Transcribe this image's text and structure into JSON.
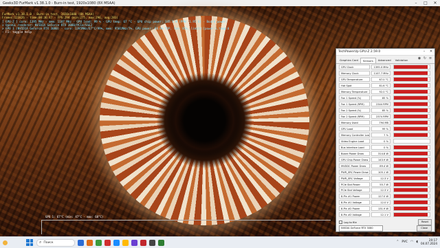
{
  "furmark": {
    "title": "Geeks3D FurMark v1.38.1.0 - Burn-in test, 1920x1080 (8X MSAA)",
    "overlay": [
      {
        "text": "FurMark v1.38.1.0 - Burn-in test, 1920x1080 (8X MSAA)",
        "style": "yellow"
      },
      {
        "text": "Frames:123826 - time:00:36:47 - FPS:294 (min:275, max:296, avg:283)",
        "style": "yellow"
      },
      {
        "text": "[ GPU-Z ] core: 1395 MHz - mem: 1107 MHz - GPU load: 99 % - GPU temp: 67 °C - GPU chip power: 145.3 W (PPW: 1.95 6) - Board power: 314.8 W (PPW: 0.935) - GPU voltage: 0.737 V",
        "style": "cyan"
      },
      {
        "text": "> OpenGL renderer: NVIDIA GeForce RTX 3080/PCIe/SSE2",
        "style": "cyan"
      },
      {
        "text": "> GPU 1 (NVIDIA GeForce RTX 3080) - core: 1395MHz/67°C/99%, mem: 9501MHz/7%, GPU power: 98.0% TDP, fan: 85%, limits:[power:1,temp:0,volt:0, OV:0]",
        "style": "cyan"
      },
      {
        "text": "- F1: toggle help",
        "style": "white"
      }
    ],
    "gpu_graph_label": "GPU 1: 67°C (min: 47°C - max: 68°C)"
  },
  "gpuz": {
    "title": "TechPowerUp GPU-Z 2.59.0",
    "tabs": [
      "Graphics Card",
      "Sensors",
      "Advanced",
      "Validation"
    ],
    "active_tab": "Sensors",
    "sensors": [
      {
        "name": "GPU Clock",
        "value": "1395.0 MHz",
        "level": 0.95
      },
      {
        "name": "Memory Clock",
        "value": "1107.7 MHz",
        "level": 0.95
      },
      {
        "name": "GPU Temperature",
        "value": "67.0 °C",
        "level": 0.95
      },
      {
        "name": "Hot Spot",
        "value": "81.6 °C",
        "level": 0.95
      },
      {
        "name": "Memory Temperature",
        "value": "92.0 °C",
        "level": 0.95
      },
      {
        "name": "Fan 1 Speed (%)",
        "value": "85 %",
        "level": 0.95
      },
      {
        "name": "Fan 1 Speed (RPM)",
        "value": "2344 RPM",
        "level": 0.95
      },
      {
        "name": "Fan 2 Speed (%)",
        "value": "85 %",
        "level": 0.95
      },
      {
        "name": "Fan 2 Speed (RPM)",
        "value": "2374 RPM",
        "level": 0.95
      },
      {
        "name": "Memory Used",
        "value": "794 MB",
        "level": 0.95
      },
      {
        "name": "GPU Load",
        "value": "99 %",
        "level": 0.95
      },
      {
        "name": "Memory Controller Load",
        "value": "7 %",
        "level": 0.95
      },
      {
        "name": "Video Engine Load",
        "value": "0 %",
        "level": 0.0
      },
      {
        "name": "Bus Interface Load",
        "value": "0 %",
        "level": 0.95
      },
      {
        "name": "Board Power Draw",
        "value": "314.8 W",
        "level": 0.95
      },
      {
        "name": "GPU Chip Power Draw",
        "value": "143.9 W",
        "level": 0.95
      },
      {
        "name": "MVDDC Power Draw",
        "value": "89.4 W",
        "level": 0.95
      },
      {
        "name": "PWR_SRC Power Draw",
        "value": "105.1 W",
        "level": 0.95
      },
      {
        "name": "PWR_SRC Voltage",
        "value": "12.3 V",
        "level": 0.95
      },
      {
        "name": "PCIe Slot Power",
        "value": "55.7 W",
        "level": 0.95
      },
      {
        "name": "PCIe Slot Voltage",
        "value": "12.3 V",
        "level": 0.95
      },
      {
        "name": "8-Pin #1 Power",
        "value": "127.0 W",
        "level": 0.95
      },
      {
        "name": "8-Pin #1 Voltage",
        "value": "12.0 V",
        "level": 0.95
      },
      {
        "name": "8-Pin #2 Power",
        "value": "131.9 W",
        "level": 0.95
      },
      {
        "name": "8-Pin #2 Voltage",
        "value": "12.1 V",
        "level": 0.95
      }
    ],
    "log_label": "Log to file",
    "reset_label": "Reset",
    "device_select": "NVIDIA GeForce RTX 3080",
    "close_label": "Close"
  },
  "taskbar": {
    "search_placeholder": "Поиск",
    "language": "РУС",
    "time": "20:17",
    "date": "04.07.2024",
    "apps": [
      "#2b6cd6",
      "#e06c1a",
      "#3c9a3c",
      "#d02f2f",
      "#1a8cff",
      "#ffb900",
      "#6a3fd1",
      "#c1272d",
      "#444444",
      "#2e7d32"
    ]
  },
  "colors": {
    "bar_fill": "#cc1f1f",
    "accent": "#1f78d1"
  }
}
